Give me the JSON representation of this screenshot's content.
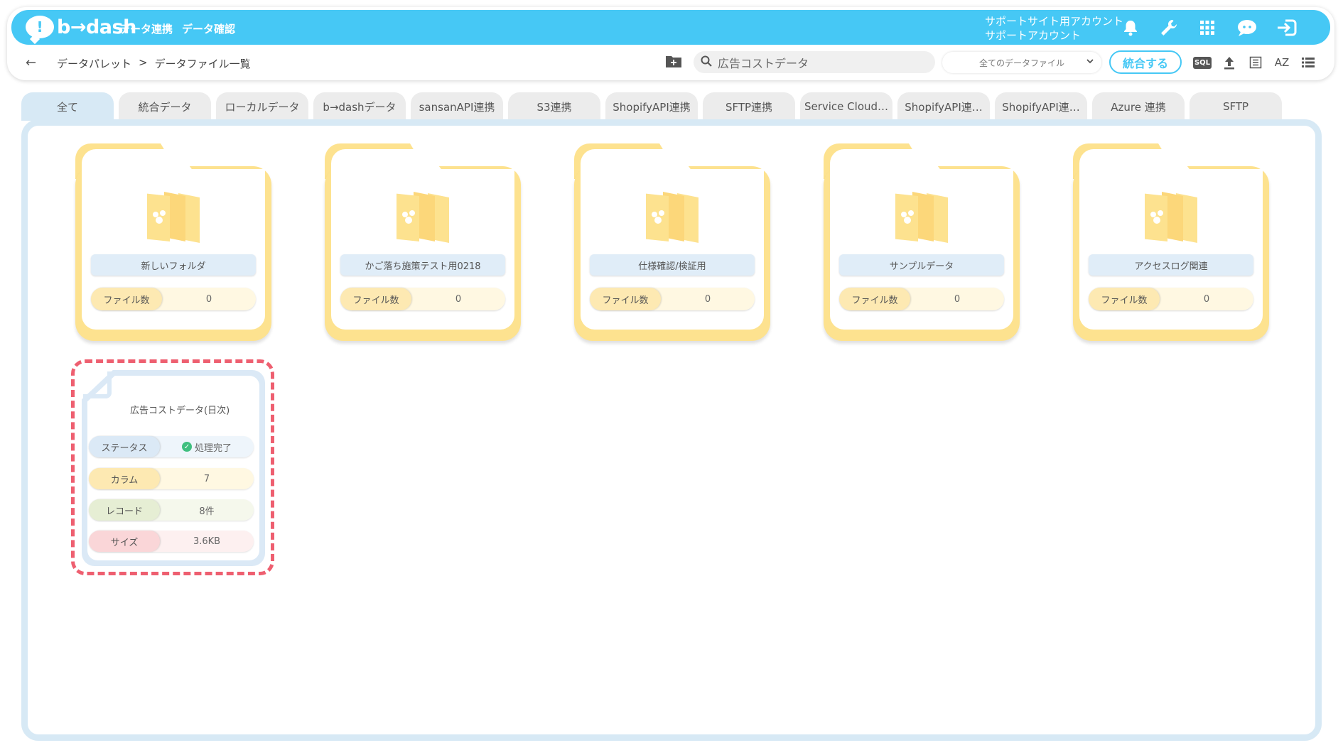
{
  "brand": {
    "logo_text": "b→dash"
  },
  "nav": {
    "item1": "データ連携",
    "item2": "データ確認"
  },
  "account": {
    "line1": "サポートサイト用アカウント",
    "line2": "サポートアカウント"
  },
  "header_icons": [
    "bell-icon",
    "wrench-icon",
    "grid-icon",
    "chat-icon",
    "logout-icon"
  ],
  "breadcrumb": {
    "root": "データパレット",
    "sep": ">",
    "current": "データファイル一覧"
  },
  "search": {
    "value": "広告コストデータ"
  },
  "filter": {
    "selected": "全てのデータファイル"
  },
  "merge_button": "統合する",
  "toolbar_icons": {
    "sql": "SQL",
    "az": "AZ"
  },
  "tabs": [
    {
      "label": "全て"
    },
    {
      "label": "統合データ"
    },
    {
      "label": "ローカルデータ"
    },
    {
      "label": "b→dashデータ"
    },
    {
      "label": "sansanAPI連携"
    },
    {
      "label": "S3連携"
    },
    {
      "label": "ShopifyAPI連携"
    },
    {
      "label": "SFTP連携"
    },
    {
      "label": "Service Cloud…"
    },
    {
      "label": "ShopifyAPI連…"
    },
    {
      "label": "ShopifyAPI連…"
    },
    {
      "label": "Azure 連携"
    },
    {
      "label": "SFTP"
    }
  ],
  "folders": [
    {
      "name": "新しいフォルダ",
      "count_label": "ファイル数",
      "count": "0"
    },
    {
      "name": "かご落ち施策テスト用0218",
      "count_label": "ファイル数",
      "count": "0"
    },
    {
      "name": "仕様確認/検証用",
      "count_label": "ファイル数",
      "count": "0"
    },
    {
      "name": "サンプルデータ",
      "count_label": "ファイル数",
      "count": "0"
    },
    {
      "name": "アクセスログ関連",
      "count_label": "ファイル数",
      "count": "0"
    }
  ],
  "file": {
    "name": "広告コストデータ(日次)",
    "status_label": "ステータス",
    "status_value": "処理完了",
    "column_label": "カラム",
    "column_value": "7",
    "record_label": "レコード",
    "record_value": "8件",
    "size_label": "サイズ",
    "size_value": "3.6KB"
  },
  "colors": {
    "brand_blue": "#46c8f5",
    "folder_yellow": "#fde28f",
    "highlight_red": "#ee5f70",
    "status_green": "#3fbf7f"
  }
}
